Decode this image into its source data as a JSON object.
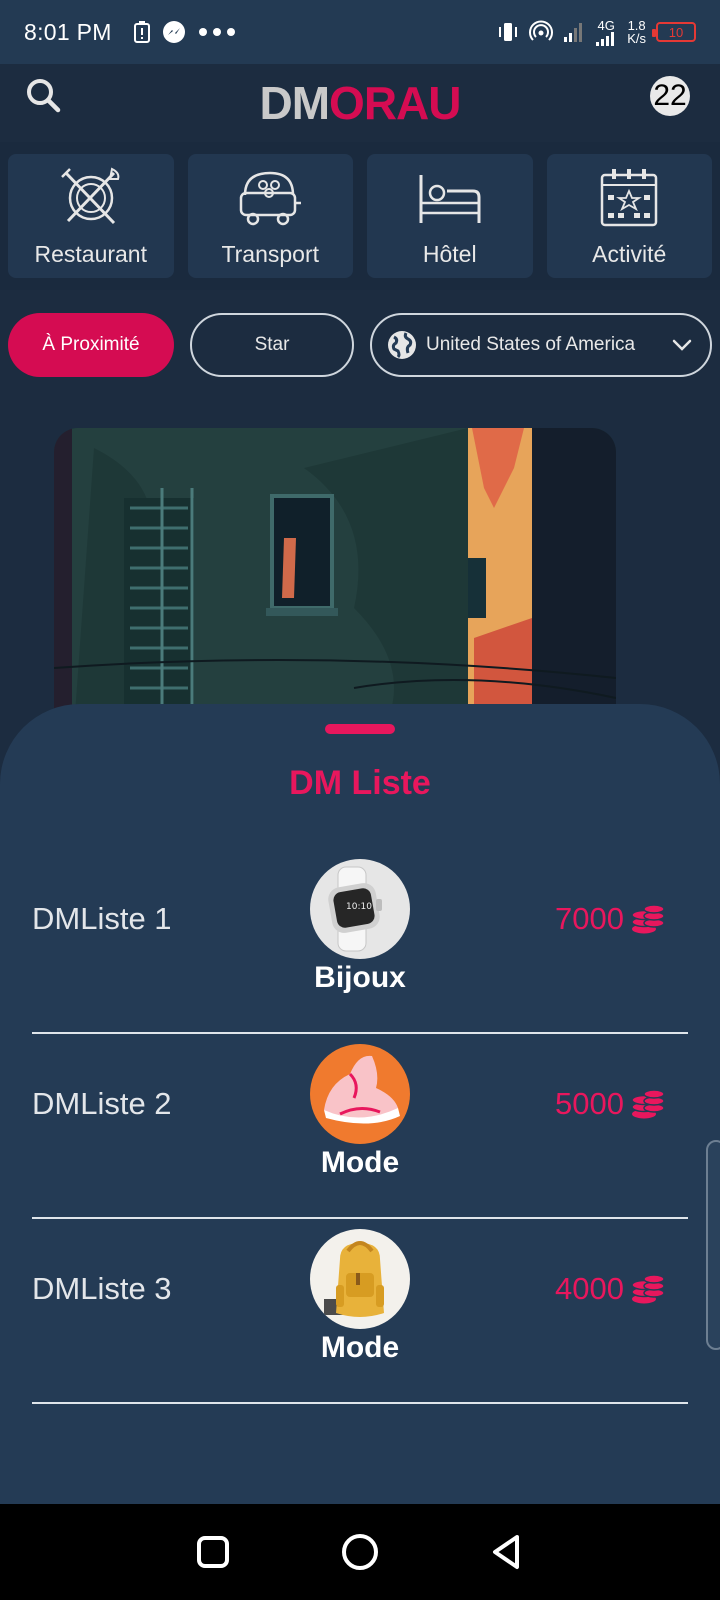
{
  "status_bar": {
    "time": "8:01 PM",
    "network_type": "4G",
    "speed_value": "1.8",
    "speed_unit": "K/s",
    "battery": "10"
  },
  "header": {
    "logo_part1": "DM",
    "logo_part2": "ORAU",
    "notification_count": "22"
  },
  "categories": [
    {
      "label": "Restaurant",
      "icon": "restaurant-icon"
    },
    {
      "label": "Transport",
      "icon": "transport-icon"
    },
    {
      "label": "Hôtel",
      "icon": "hotel-icon"
    },
    {
      "label": "Activité",
      "icon": "activity-icon"
    }
  ],
  "filters": {
    "nearby": "À Proximité",
    "star": "Star",
    "country": "United States of America"
  },
  "sheet": {
    "title": "DM Liste",
    "items": [
      {
        "name": "DMListe 1",
        "category": "Bijoux",
        "price": "7000"
      },
      {
        "name": "DMListe 2",
        "category": "Mode",
        "price": "5000"
      },
      {
        "name": "DMListe 3",
        "category": "Mode",
        "price": "4000"
      }
    ]
  },
  "colors": {
    "accent": "#d50c52",
    "background": "#1c2c40",
    "sheet": "#243b55"
  }
}
